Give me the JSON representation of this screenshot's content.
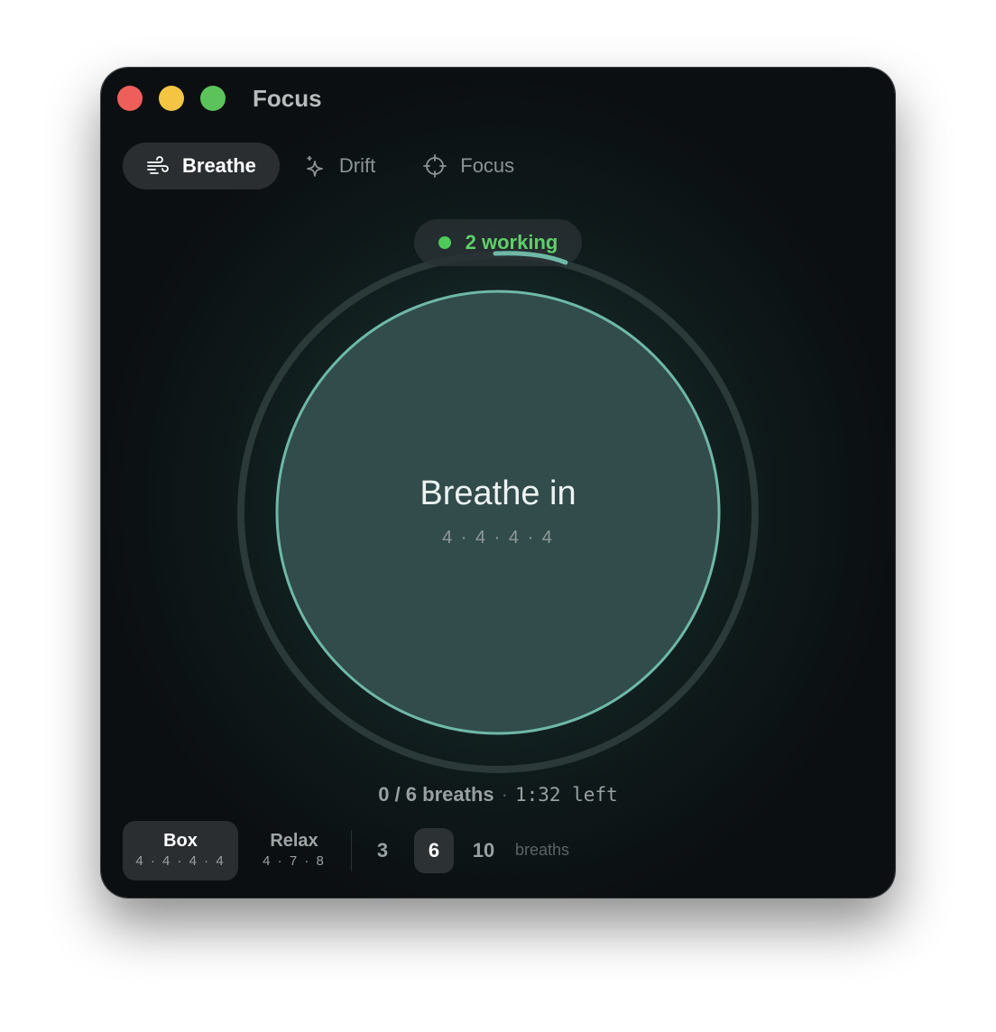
{
  "window": {
    "title": "Focus",
    "traffic_lights": [
      "close",
      "minimize",
      "maximize"
    ]
  },
  "tabs": [
    {
      "label": "Breathe",
      "icon": "wind-icon",
      "active": true
    },
    {
      "label": "Drift",
      "icon": "sparkle-icon",
      "active": false
    },
    {
      "label": "Focus",
      "icon": "crosshair-icon",
      "active": false
    }
  ],
  "status": {
    "text": "2 working",
    "color": "#5fcf6a"
  },
  "session": {
    "phase": "Breathe in",
    "pattern": "4 · 4 · 4 · 4",
    "breaths_text": "0 / 6 breaths",
    "separator": "·",
    "time_left": "1:32 left",
    "completed_breaths": 0,
    "total_breaths": 6
  },
  "presets": [
    {
      "name": "Box",
      "pattern": "4 · 4 · 4 · 4",
      "active": true
    },
    {
      "name": "Relax",
      "pattern": "4 · 7 · 8",
      "active": false
    }
  ],
  "breath_counts": {
    "options": [
      "3",
      "6",
      "10"
    ],
    "selected": "6",
    "unit": "breaths"
  },
  "colors": {
    "accent": "#6fb8a8",
    "status_green": "#4fc95a",
    "circle_fill": "#314c4b"
  }
}
